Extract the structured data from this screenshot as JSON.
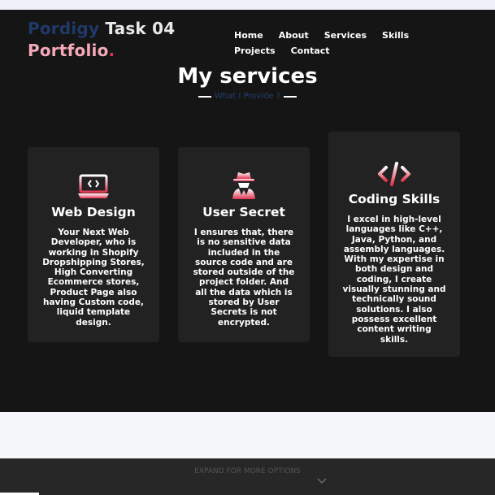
{
  "logo": {
    "word1": "Pordigy",
    "word2": "Task 04",
    "word3": "Portfolio",
    "dot": "."
  },
  "nav": {
    "items": [
      "Home",
      "About",
      "Services",
      "Skills",
      "Projects",
      "Contact"
    ]
  },
  "services": {
    "heading": "My services",
    "subheading": "What I Provide ?",
    "cards": [
      {
        "icon": "laptop-code-icon",
        "title": "Web Design",
        "description": "Your Next Web Developer, who is working in Shopify Dropshipping Stores, High Converting Ecommerce stores, Product Page also having Custom code, liquid template design."
      },
      {
        "icon": "user-secret-icon",
        "title": "User Secret",
        "description": "I ensures that, there is no sensitive data included in the source code and are stored outside of the project folder. And all the data which is stored by User Secrets is not encrypted."
      },
      {
        "icon": "code-icon",
        "title": "Coding Skills",
        "description": "I excel in high-level languages like C++, Java, Python, and assembly languages. With my expertise in both design and coding, I create visually stunning and technically sound solutions. I also possess excellent content writing skills."
      }
    ]
  },
  "footer": {
    "expand_label": "EXPAND FOR MORE OPTIONS",
    "chevron_icon": "chevron-down-icon"
  },
  "colors": {
    "page_bg": "#151515",
    "card_bg": "#222222",
    "accent_pink": "#e23450",
    "accent_blue": "#1f3a68"
  }
}
